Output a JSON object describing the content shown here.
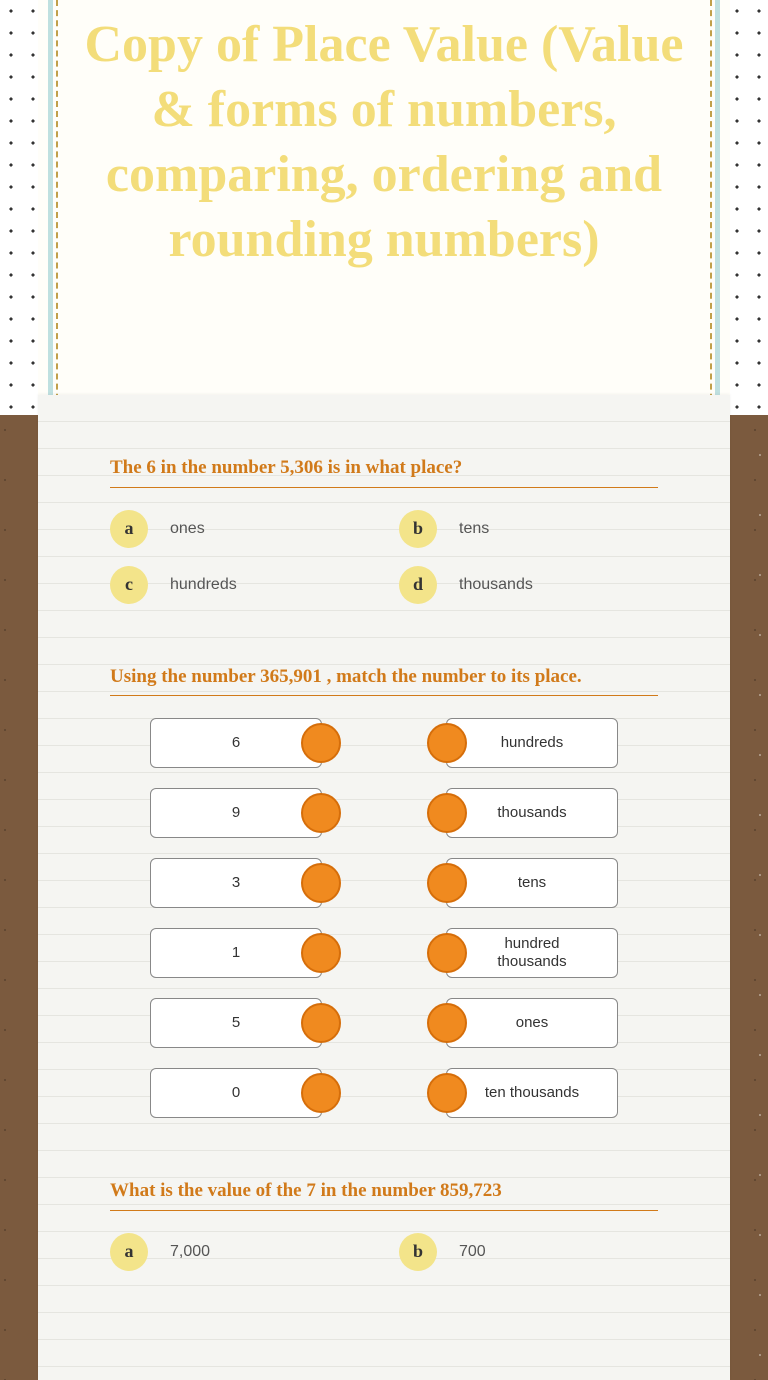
{
  "title": "Copy of Place Value (Value & forms of numbers, comparing, ordering and rounding numbers)",
  "q1": {
    "prompt": "The 6 in the number 5,306 is in what place?",
    "a": {
      "letter": "a",
      "text": "ones"
    },
    "b": {
      "letter": "b",
      "text": "tens"
    },
    "c": {
      "letter": "c",
      "text": "hundreds"
    },
    "d": {
      "letter": "d",
      "text": "thousands"
    }
  },
  "q2": {
    "prompt": "Using the number  365,901 , match the number to its place.",
    "left": [
      "6",
      "9",
      "3",
      "1",
      "5",
      "0"
    ],
    "right": [
      "hundreds",
      "thousands",
      "tens",
      "hundred thousands",
      "ones",
      "ten thousands"
    ]
  },
  "q3": {
    "prompt": "What is the value of the 7 in the number 859,723",
    "a": {
      "letter": "a",
      "text": "7,000"
    },
    "b": {
      "letter": "b",
      "text": "700"
    }
  }
}
